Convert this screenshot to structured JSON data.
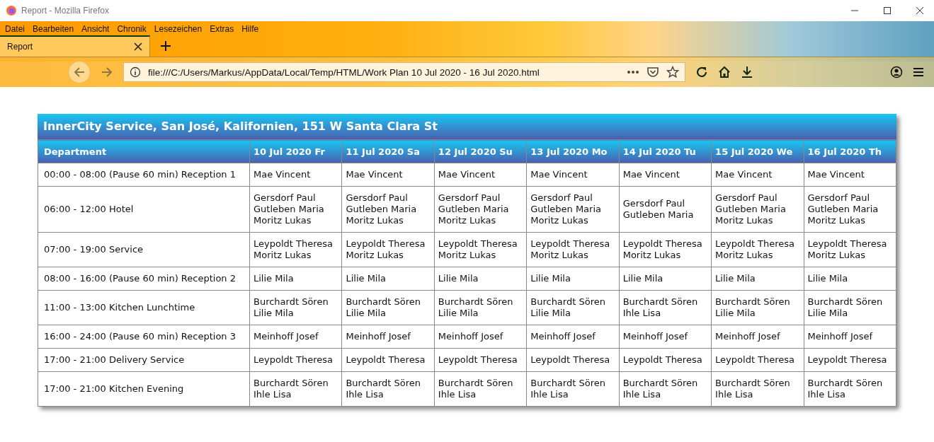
{
  "window": {
    "title": "Report - Mozilla Firefox"
  },
  "menu": [
    "Datei",
    "Bearbeiten",
    "Ansicht",
    "Chronik",
    "Lesezeichen",
    "Extras",
    "Hilfe"
  ],
  "tabs": [
    {
      "label": "Report",
      "selected": true
    }
  ],
  "address_bar": {
    "url": "file:///C:/Users/Markus/AppData/Local/Temp/HTML/Work Plan 10 Jul 2020 - 16 Jul 2020.html"
  },
  "report": {
    "title": "InnerCity Service, San José, Kalifornien, 151 W Santa Clara St",
    "columns": [
      "Department",
      "10 Jul 2020 Fr",
      "11 Jul 2020 Sa",
      "12 Jul 2020 Su",
      "13 Jul 2020 Mo",
      "14 Jul 2020 Tu",
      "15 Jul 2020 We",
      "16 Jul 2020 Th"
    ],
    "rows": [
      [
        "00:00 - 08:00 (Pause 60 min) Reception 1",
        "Mae Vincent",
        "Mae Vincent",
        "Mae Vincent",
        "Mae Vincent",
        "Mae Vincent",
        "Mae Vincent",
        "Mae Vincent"
      ],
      [
        "06:00 - 12:00 Hotel",
        "Gersdorf Paul\nGutleben Maria\nMoritz Lukas",
        "Gersdorf Paul\nGutleben Maria\nMoritz Lukas",
        "Gersdorf Paul\nGutleben Maria\nMoritz Lukas",
        "Gersdorf Paul\nGutleben Maria\nMoritz Lukas",
        "Gersdorf Paul\nGutleben Maria",
        "Gersdorf Paul\nGutleben Maria\nMoritz Lukas",
        "Gersdorf Paul\nGutleben Maria\nMoritz Lukas"
      ],
      [
        "07:00 - 19:00 Service",
        "Leypoldt Theresa\nMoritz Lukas",
        "Leypoldt Theresa\nMoritz Lukas",
        "Leypoldt Theresa\nMoritz Lukas",
        "Leypoldt Theresa\nMoritz Lukas",
        "Leypoldt Theresa\nMoritz Lukas",
        "Leypoldt Theresa\nMoritz Lukas",
        "Leypoldt Theresa\nMoritz Lukas"
      ],
      [
        "08:00 - 16:00 (Pause 60 min) Reception 2",
        "Lilie Mila",
        "Lilie Mila",
        "Lilie Mila",
        "Lilie Mila",
        "Lilie Mila",
        "Lilie Mila",
        "Lilie Mila"
      ],
      [
        "11:00 - 13:00 Kitchen Lunchtime",
        "Burchardt Sören\nLilie Mila",
        "Burchardt Sören\nLilie Mila",
        "Burchardt Sören\nLilie Mila",
        "Burchardt Sören\nLilie Mila",
        "Burchardt Sören\nIhle Lisa",
        "Burchardt Sören\nLilie Mila",
        "Burchardt Sören\nLilie Mila"
      ],
      [
        "16:00 - 24:00 (Pause 60 min) Reception 3",
        "Meinhoff Josef",
        "Meinhoff Josef",
        "Meinhoff Josef",
        "Meinhoff Josef",
        "Meinhoff Josef",
        "Meinhoff Josef",
        "Meinhoff Josef"
      ],
      [
        "17:00 - 21:00 Delivery Service",
        "Leypoldt Theresa",
        "Leypoldt Theresa",
        "Leypoldt Theresa",
        "Leypoldt Theresa",
        "Leypoldt Theresa",
        "Leypoldt Theresa",
        "Leypoldt Theresa"
      ],
      [
        "17:00 - 21:00 Kitchen Evening",
        "Burchardt Sören\nIhle Lisa",
        "Burchardt Sören\nIhle Lisa",
        "Burchardt Sören\nIhle Lisa",
        "Burchardt Sören\nIhle Lisa",
        "Burchardt Sören\nIhle Lisa",
        "Burchardt Sören\nIhle Lisa",
        "Burchardt Sören\nIhle Lisa"
      ]
    ]
  }
}
